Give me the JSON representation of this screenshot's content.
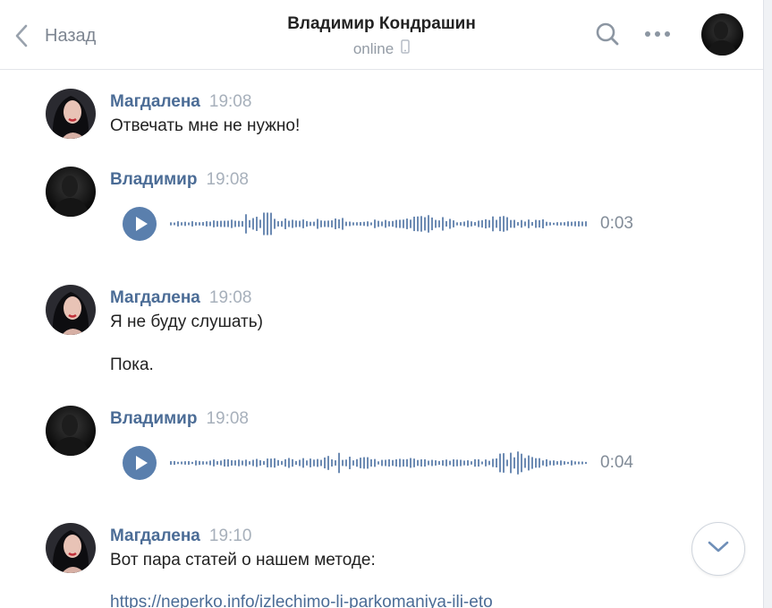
{
  "header": {
    "back_label": "Назад",
    "title": "Владимир Кондрашин",
    "status": "online"
  },
  "colors": {
    "accent": "#5a7fad",
    "name": "#4b6c96",
    "muted": "#a7b0bb"
  },
  "icons": [
    "chevron-left-icon",
    "search-icon",
    "more-icon",
    "phone-icon",
    "play-icon",
    "chevron-down-icon"
  ],
  "messages": [
    {
      "author": "Магдалена",
      "time": "19:08",
      "lines": [
        "Отвечать мне не нужно!"
      ]
    },
    {
      "author": "Владимир",
      "time": "19:08",
      "voice_duration": "0:03"
    },
    {
      "author": "Магдалена",
      "time": "19:08",
      "lines": [
        "Я не буду слушать)",
        "Пока."
      ]
    },
    {
      "author": "Владимир",
      "time": "19:08",
      "voice_duration": "0:04"
    },
    {
      "author": "Магдалена",
      "time": "19:10",
      "lines": [
        "Вот пара статей о нашем методе:"
      ],
      "link": "https://neperko.info/izlechimo-li-parkomaniya-ili-eto"
    }
  ]
}
